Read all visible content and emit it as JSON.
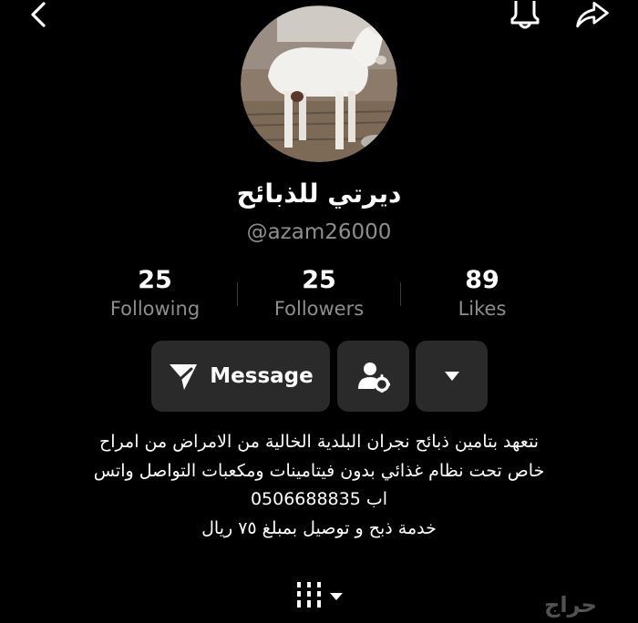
{
  "header": {
    "back_icon": "chevron-left-icon",
    "bell_icon": "bell-icon",
    "share_icon": "share-arrow-icon"
  },
  "profile": {
    "display_name": "ديرتي للذبائح",
    "username": "@azam26000",
    "avatar": "white-goat-photo"
  },
  "stats": {
    "following": {
      "value": "25",
      "label": "Following"
    },
    "followers": {
      "value": "25",
      "label": "Followers"
    },
    "likes": {
      "value": "89",
      "label": "Likes"
    }
  },
  "actions": {
    "message_label": "Message",
    "message_icon": "send-icon",
    "follow_settings_icon": "person-gear-icon",
    "more_icon": "caret-down-icon"
  },
  "bio": {
    "lines": [
      "نتعهد بتامين ذبائح نجران البلدية الخالية من الامراض من امراح",
      "خاص تحت نظام غذائي بدون فيتامينات ومكعبات التواصل واتس",
      "اب 0506688835",
      "خدمة ذبح و توصيل بمبلغ ٧٥ ريال"
    ]
  },
  "tabs": {
    "icon": "grid-columns-icon"
  },
  "watermark": {
    "text": "حراج"
  },
  "colors": {
    "background": "#000000",
    "button": "#2a2a2a",
    "muted_text": "#8e8e8e"
  }
}
